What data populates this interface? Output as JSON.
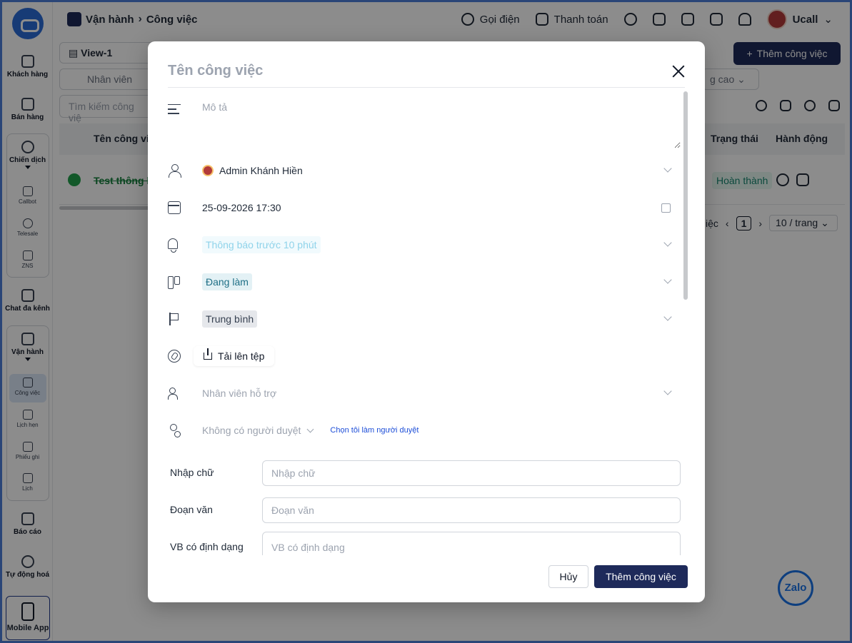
{
  "topbar": {
    "crumb_root": "Vận hành",
    "crumb_current": "Công việc",
    "call_label": "Gọi điện",
    "payment_label": "Thanh toán",
    "user_name": "Ucall"
  },
  "sidebar": {
    "items": {
      "customers": "Khách hàng",
      "sales": "Bán hàng",
      "campaign": "Chiến dịch",
      "callbot": "Callbot",
      "telesale": "Telesale",
      "zns": "ZNS",
      "omnichat": "Chat đa kênh",
      "operations": "Vận hành",
      "tasks": "Công việc",
      "appointments": "Lịch hẹn",
      "tickets": "Phiếu ghi",
      "calendar": "Lịch",
      "reports": "Báo cáo",
      "automation": "Tự động hoá",
      "mobile": "Mobile App"
    }
  },
  "list": {
    "view_name": "View-1",
    "add_button": "Thêm công việc",
    "filter_staff": "Nhân viên",
    "advanced_filter": "g cao",
    "search_placeholder": "Tìm kiếm công việ",
    "columns": {
      "name": "Tên công việ",
      "status": "Trạng thái",
      "action": "Hành động"
    },
    "rows": [
      {
        "name": "Test thông b",
        "status": "Hoàn thành"
      }
    ],
    "pager_prefix": "iệc",
    "page": "1",
    "page_size": "10 / trang"
  },
  "zalo_label": "Zalo",
  "modal": {
    "title_placeholder": "Tên công việc",
    "description_placeholder": "Mô tả",
    "assignee": "Admin Khánh Hiền",
    "datetime": "25-09-2026 17:30",
    "reminder": "Thông báo trước 10 phút",
    "status": "Đang làm",
    "priority": "Trung bình",
    "upload_label": "Tải lên tệp",
    "support_staff_placeholder": "Nhân viên hỗ trợ",
    "approver_placeholder": "Không có người duyệt",
    "self_approve_link": "Chọn tôi làm người duyệt",
    "fields": [
      {
        "label": "Nhập chữ",
        "placeholder": "Nhập chữ"
      },
      {
        "label": "Đoạn văn",
        "placeholder": "Đoạn văn"
      },
      {
        "label": "VB có định dạng",
        "placeholder": "VB có định dạng"
      }
    ],
    "cancel_label": "Hủy",
    "submit_label": "Thêm công việc"
  },
  "colors": {
    "primary": "#1e2a5a",
    "status_done_bg": "#e6f7f1",
    "status_done_text": "#16866f",
    "doing_tag_bg": "#e3f1f5",
    "link": "#1d4ed8"
  }
}
